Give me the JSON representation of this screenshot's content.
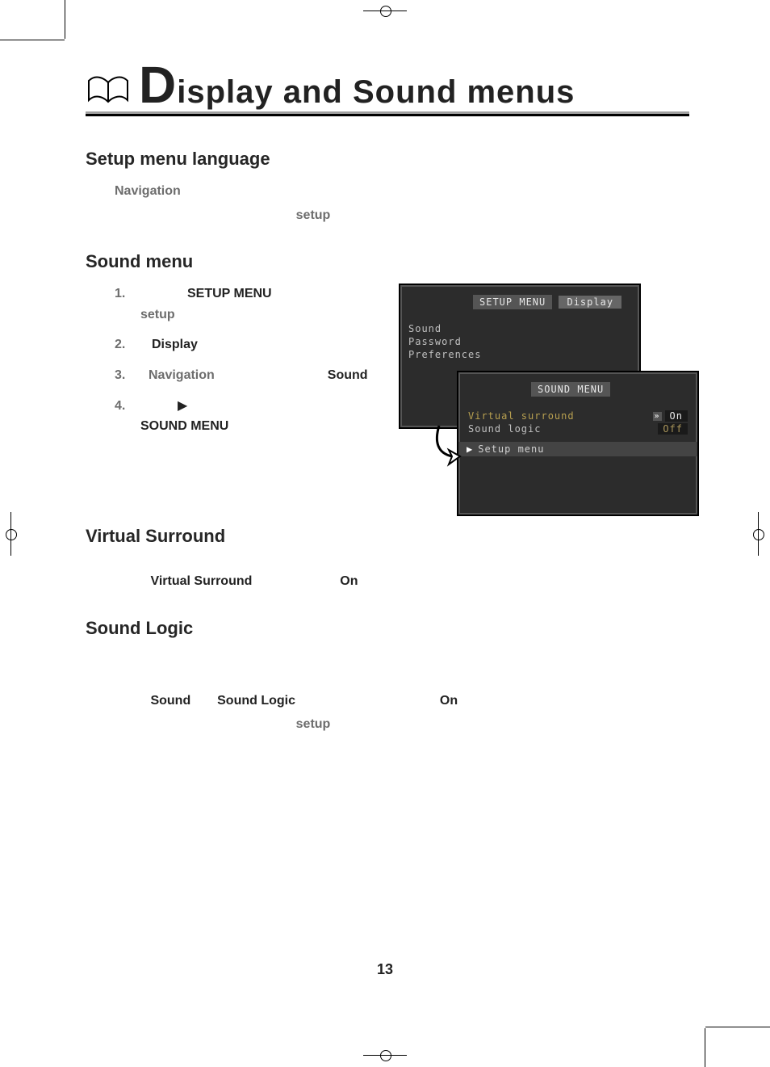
{
  "title": {
    "big": "D",
    "rest": "isplay and Sound menus"
  },
  "sec1": {
    "heading": "Setup menu language",
    "line1_lead": "Navigation",
    "line2_lead": "setup"
  },
  "sec2": {
    "heading": "Sound menu",
    "step1_a": "SETUP MENU",
    "step1_b": "setup",
    "step2_a": "Display",
    "step3_a": "Navigation",
    "step3_b": "Sound",
    "step4_b": "SOUND MENU",
    "nums": {
      "n1": "1.",
      "n2": "2.",
      "n3": "3.",
      "n4": "4."
    }
  },
  "tv1": {
    "title": "SETUP MENU",
    "items": [
      "Display",
      "Sound",
      "Password",
      "Preferences"
    ]
  },
  "tv2": {
    "title": "SOUND MENU",
    "row1": {
      "label": "Virtual surround",
      "value": "On"
    },
    "row2": {
      "label": "Sound logic",
      "value": "Off"
    },
    "footer": "Setup menu"
  },
  "sec3": {
    "heading": "Virtual Surround",
    "line_a": "Virtual Surround",
    "line_b": "On"
  },
  "sec4": {
    "heading": "Sound Logic",
    "line_a": "Sound",
    "line_b": "Sound Logic",
    "line_c": "On",
    "line_d": "setup"
  },
  "pagenum": "13"
}
